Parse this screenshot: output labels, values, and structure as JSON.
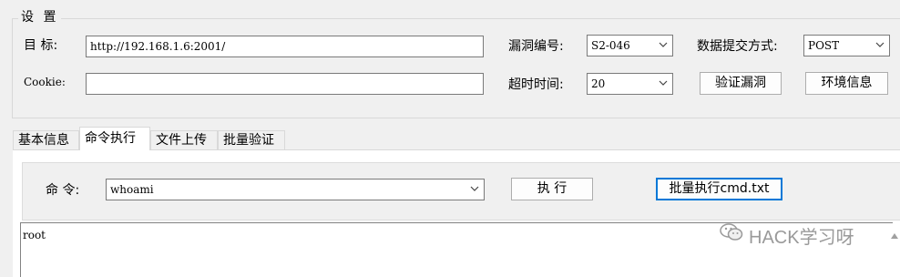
{
  "settings": {
    "group_title": "设 置",
    "target_label": "目  标:",
    "target_value": "http://192.168.1.6:2001/",
    "cookie_label": "Cookie:",
    "cookie_value": "",
    "vuln_id_label": "漏洞编号:",
    "vuln_id_value": "S2-046",
    "timeout_label": "超时时间:",
    "timeout_value": "20",
    "submit_method_label": "数据提交方式:",
    "submit_method_value": "POST",
    "verify_button": "验证漏洞",
    "env_info_button": "环境信息"
  },
  "tabs": [
    {
      "label": "基本信息"
    },
    {
      "label": "命令执行",
      "active": true
    },
    {
      "label": "文件上传"
    },
    {
      "label": "批量验证"
    }
  ],
  "command_panel": {
    "command_label": "命  令:",
    "command_value": "whoami",
    "execute_button": "执 行",
    "batch_execute_button": "批量执行cmd.txt"
  },
  "output": {
    "text": "root"
  },
  "watermark": {
    "text": "HACK学习呀",
    "icon": "wechat-icon"
  }
}
